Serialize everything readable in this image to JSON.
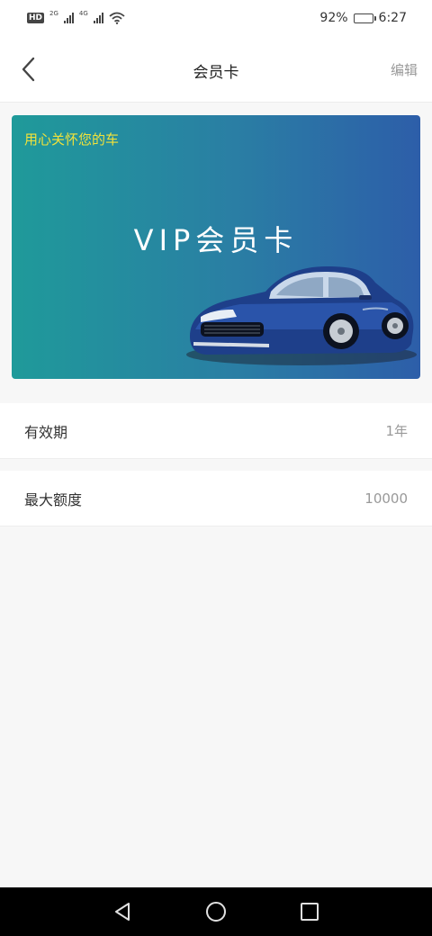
{
  "status_bar": {
    "hd": "HD",
    "sim_tag_1": "2G",
    "sim_tag_2": "4G",
    "battery_percent": "92%",
    "battery_level": 0.92,
    "time": "6:27"
  },
  "header": {
    "title": "会员卡",
    "edit_label": "编辑"
  },
  "card": {
    "slogan": "用心关怀您的车",
    "title": "VIP会员卡",
    "colors": {
      "gradient_start": "#1f9a9a",
      "gradient_end": "#2d5ea9",
      "slogan": "#f2e23a"
    }
  },
  "details": [
    {
      "label": "有效期",
      "value": "1年"
    },
    {
      "label": "最大额度",
      "value": "10000"
    }
  ],
  "icons": {
    "back": "back-arrow-icon",
    "nav_back": "triangle-back-icon",
    "nav_home": "circle-home-icon",
    "nav_recent": "square-recent-icon"
  }
}
